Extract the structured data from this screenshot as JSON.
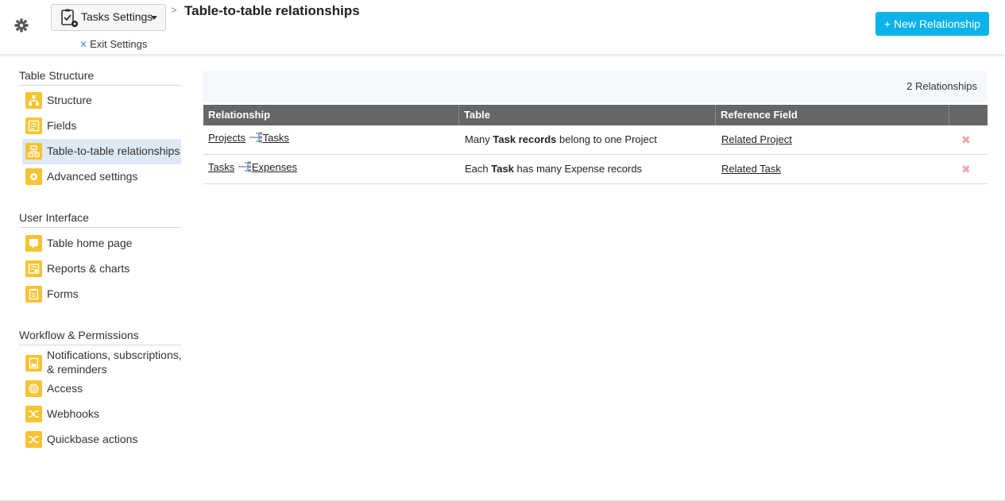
{
  "header": {
    "settings_label": "Tasks Settings",
    "exit_label": "Exit Settings",
    "separator": ">",
    "title": "Table-to-table relationships",
    "new_button": "+ New Relationship"
  },
  "sidebar": {
    "sections": [
      {
        "title": "Table Structure",
        "items": [
          {
            "label": "Structure",
            "icon": "structure-icon"
          },
          {
            "label": "Fields",
            "icon": "fields-icon"
          },
          {
            "label": "Table-to-table relationships",
            "icon": "relationships-icon",
            "active": true
          },
          {
            "label": "Advanced settings",
            "icon": "advanced-settings-icon"
          }
        ]
      },
      {
        "title": "User Interface",
        "items": [
          {
            "label": "Table home page",
            "icon": "home-page-icon"
          },
          {
            "label": "Reports & charts",
            "icon": "reports-icon"
          },
          {
            "label": "Forms",
            "icon": "forms-icon"
          }
        ]
      },
      {
        "title": "Workflow & Permissions",
        "items": [
          {
            "label": "Notifications, subscriptions, & reminders",
            "icon": "notifications-icon"
          },
          {
            "label": "Access",
            "icon": "access-icon"
          },
          {
            "label": "Webhooks",
            "icon": "webhooks-icon"
          },
          {
            "label": "Quickbase actions",
            "icon": "quickbase-actions-icon"
          }
        ]
      }
    ]
  },
  "main": {
    "count_label": "2 Relationships",
    "columns": [
      "Relationship",
      "Table",
      "Reference Field",
      ""
    ],
    "rows": [
      {
        "from": "Projects",
        "to": "Tasks",
        "desc_pre": "Many ",
        "desc_bold": "Task records",
        "desc_post": " belong to one Project",
        "ref": "Related Project",
        "delete": "✖"
      },
      {
        "from": "Tasks",
        "to": "Expenses",
        "desc_pre": "Each ",
        "desc_bold": "Task",
        "desc_post": " has many Expense records",
        "ref": "Related Task",
        "delete": "✖"
      }
    ]
  },
  "colors": {
    "accent": "#0cb2ea",
    "icon_bg": "#f7c331",
    "header_row": "#666666",
    "active_bg": "#dde9f5"
  }
}
